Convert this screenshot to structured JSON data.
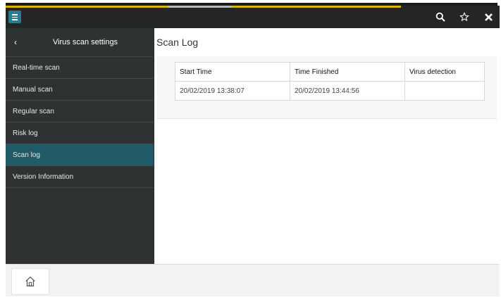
{
  "colors": {
    "accent": "#d9b400",
    "sidebar_bg": "#2f3233",
    "active_item": "#1f5a66",
    "menu_button": "#2a7c90"
  },
  "topbar": {
    "icons": [
      "menu-icon",
      "search-icon",
      "star-icon",
      "close-icon"
    ]
  },
  "sidebar": {
    "back_label": "‹",
    "title": "Virus scan settings",
    "items": [
      {
        "label": "Real-time scan"
      },
      {
        "label": "Manual scan"
      },
      {
        "label": "Regular scan"
      },
      {
        "label": "Risk log"
      },
      {
        "label": "Scan log",
        "active": true
      },
      {
        "label": "Version Information"
      }
    ]
  },
  "main": {
    "title": "Scan Log",
    "table": {
      "headers": [
        "Start Time",
        "Time Finished",
        "Virus detection"
      ],
      "rows": [
        [
          "20/02/2019 13:38:07",
          "20/02/2019 13:44:56",
          ""
        ]
      ]
    }
  },
  "bottombar": {
    "home_icon": "home-icon"
  }
}
